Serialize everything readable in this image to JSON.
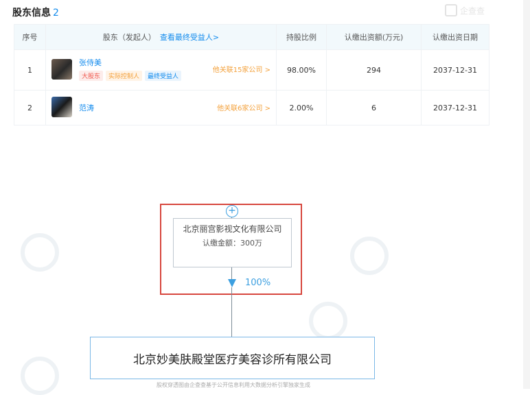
{
  "section": {
    "title": "股东信息",
    "count": "2",
    "corner_logo": "企查查"
  },
  "table": {
    "headers": {
      "index": "序号",
      "holder": "股东（发起人）",
      "holder_link": "查看最终受益人>",
      "ratio": "持股比例",
      "capital": "认缴出资额(万元)",
      "date": "认缴出资日期"
    },
    "rows": [
      {
        "index": "1",
        "name": "张侍美",
        "tags": [
          "大股东",
          "实际控制人",
          "最终受益人"
        ],
        "related": "他关联15家公司 >",
        "ratio": "98.00%",
        "capital": "294",
        "date": "2037-12-31"
      },
      {
        "index": "2",
        "name": "范涛",
        "tags": [],
        "related": "他关联6家公司 >",
        "ratio": "2.00%",
        "capital": "6",
        "date": "2037-12-31"
      }
    ]
  },
  "graph": {
    "top_company": "北京丽宫影视文化有限公司",
    "top_amount": "认缴金额：300万",
    "plus_symbol": "+",
    "percent": "100%",
    "bottom_company": "北京妙美肤殿堂医疗美容诊所有限公司",
    "footnote": "股权穿透图由企查查基于公开信息利用大数据分析引擎独家生成"
  },
  "colors": {
    "accent": "#128bed",
    "highlight_border": "#d7463d",
    "tag_red": "#f05a4f",
    "tag_orange": "#f3a03a"
  }
}
